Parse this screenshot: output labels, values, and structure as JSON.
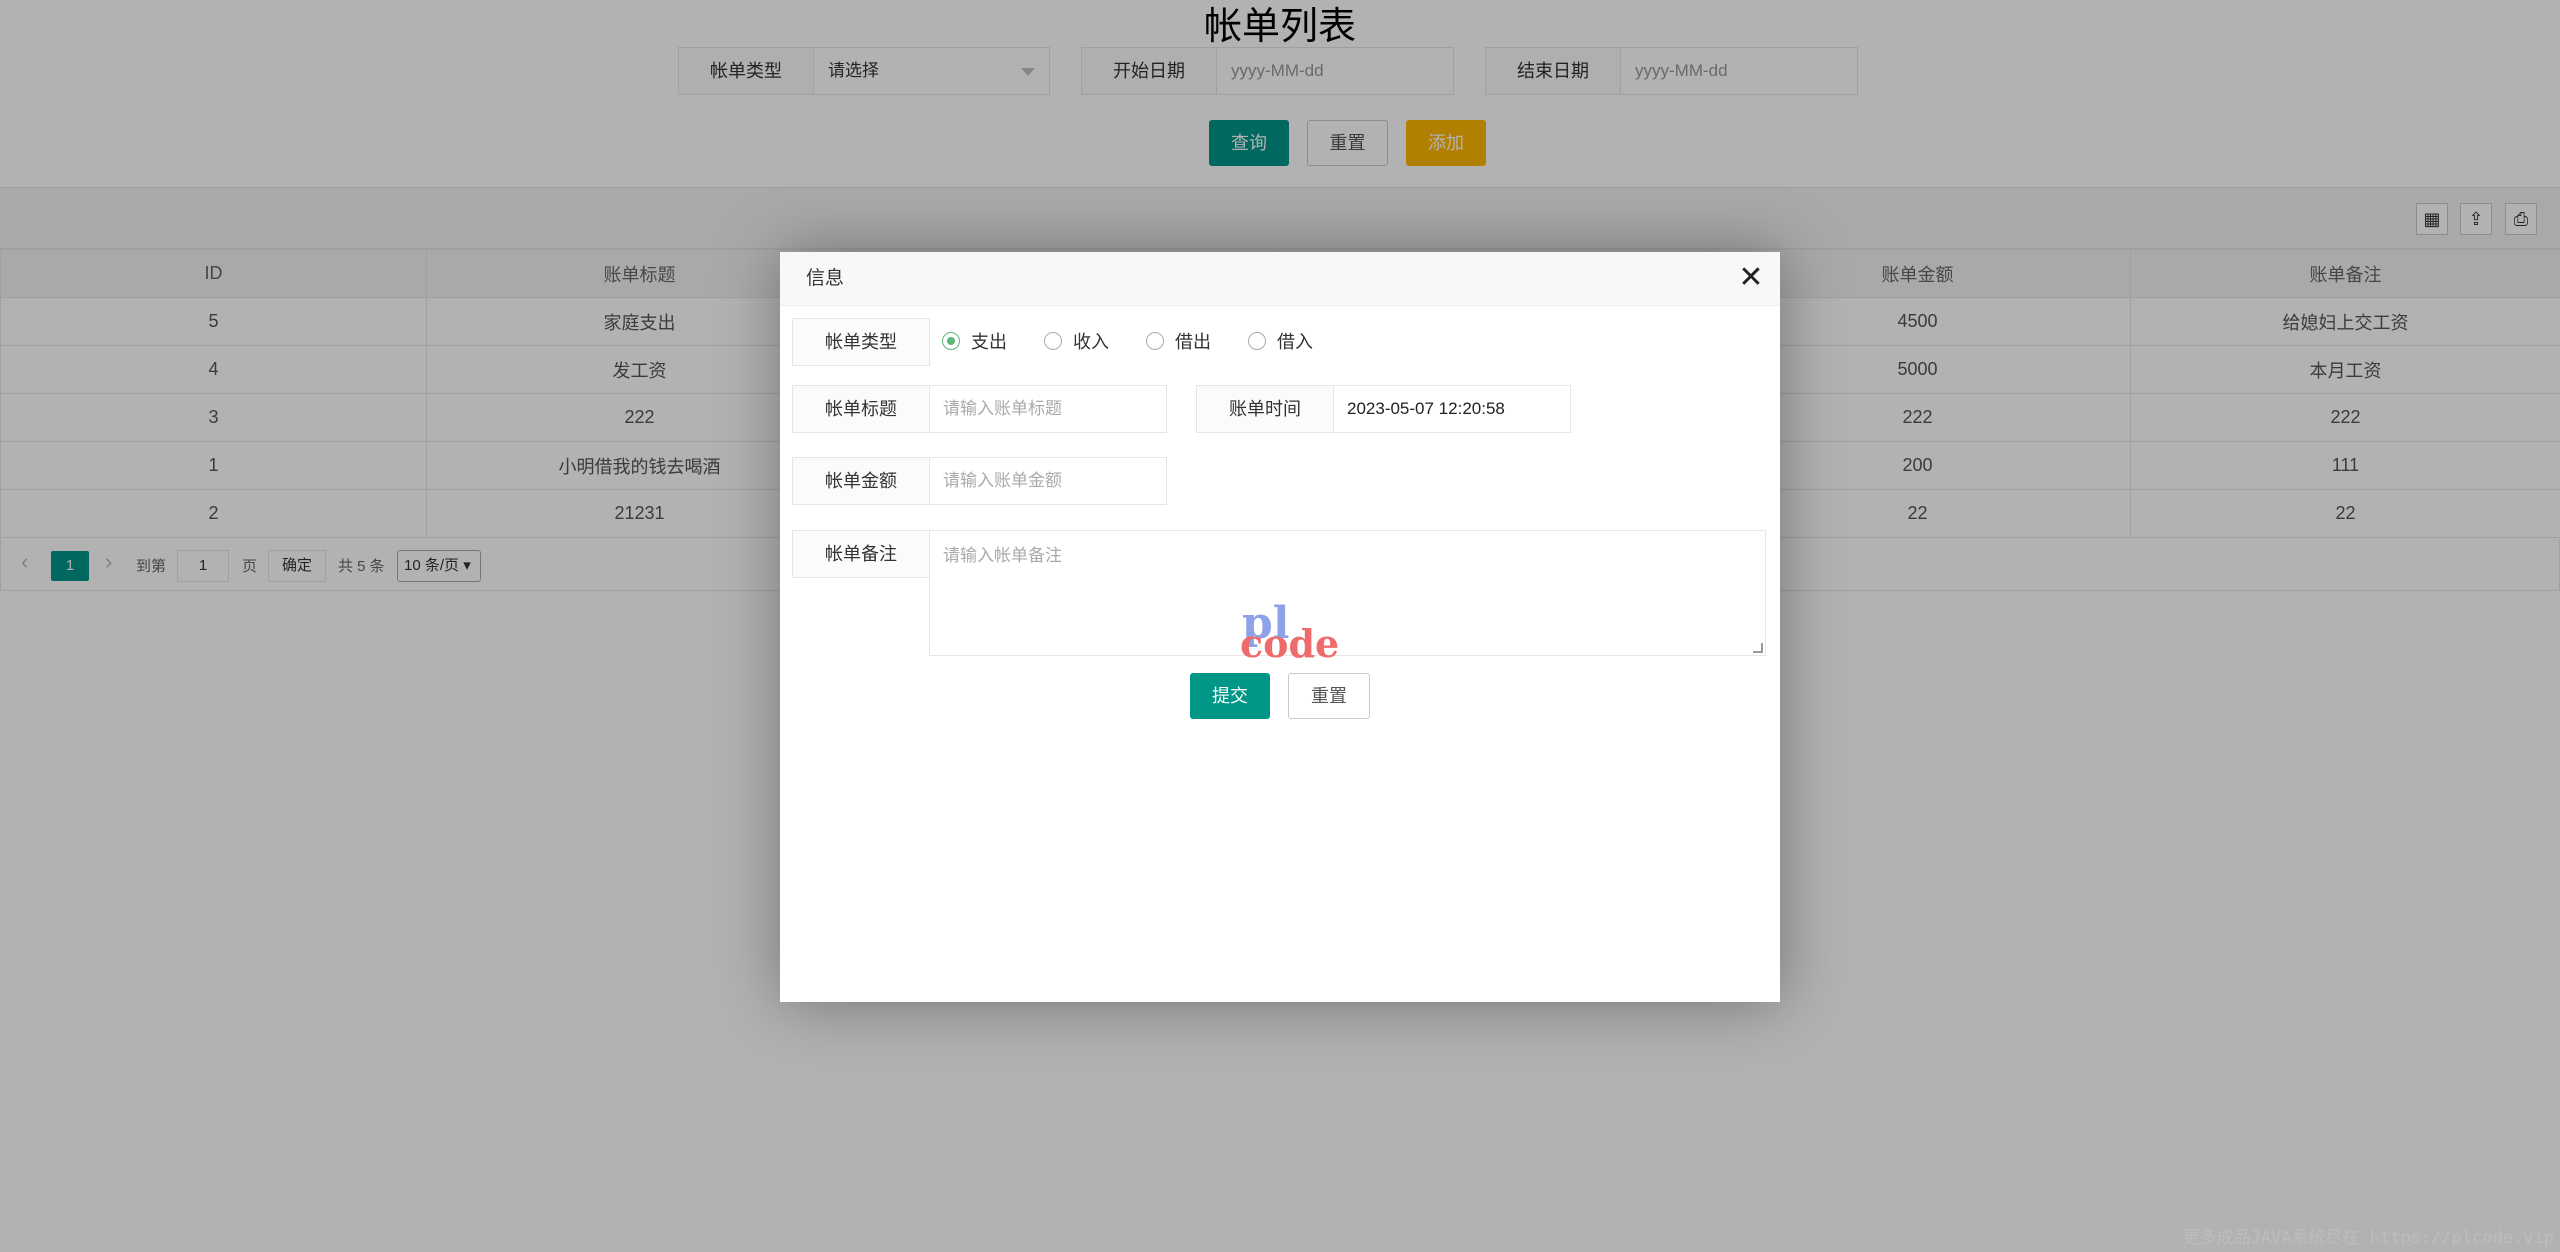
{
  "page": {
    "title": "帐单列表",
    "filters": [
      {
        "label": "帐单类型",
        "value": "请选择"
      },
      {
        "label": "开始日期",
        "placeholder": "yyyy-MM-dd"
      },
      {
        "label": "结束日期",
        "placeholder": "yyyy-MM-dd"
      }
    ],
    "buttons": {
      "query": "查询",
      "reset": "重置",
      "add": "添加"
    },
    "toolbar_icons": [
      "columns-icon",
      "export-icon",
      "print-icon"
    ],
    "table": {
      "columns": [
        "ID",
        "账单标题",
        "",
        "",
        "账单金额",
        "账单备注"
      ],
      "rows": [
        [
          "5",
          "家庭支出",
          "",
          "",
          "4500",
          "给媳妇上交工资"
        ],
        [
          "4",
          "发工资",
          "",
          "",
          "5000",
          "本月工资"
        ],
        [
          "3",
          "222",
          "",
          "",
          "222",
          "222"
        ],
        [
          "1",
          "小明借我的钱去喝酒",
          "",
          "",
          "200",
          "111"
        ],
        [
          "2",
          "21231",
          "",
          "",
          "22",
          "22"
        ]
      ]
    },
    "pager": {
      "current": "1",
      "goto_label": "到第",
      "goto_value": "1",
      "page_suffix": "页",
      "confirm": "确定",
      "total": "共 5 条",
      "page_size": "10 条/页"
    }
  },
  "modal": {
    "title": "信息",
    "close_glyph": "✕",
    "type_label": "帐单类型",
    "type_options": [
      {
        "label": "支出",
        "checked": true
      },
      {
        "label": "收入",
        "checked": false
      },
      {
        "label": "借出",
        "checked": false
      },
      {
        "label": "借入",
        "checked": false
      }
    ],
    "title_label": "帐单标题",
    "title_placeholder": "请输入账单标题",
    "time_label": "账单时间",
    "time_value": "2023-05-07 12:20:58",
    "amount_label": "帐单金额",
    "amount_placeholder": "请输入账单金额",
    "remark_label": "帐单备注",
    "remark_placeholder": "请输入帐单备注",
    "logo_line1": "pl",
    "logo_line2": "code",
    "submit": "提交",
    "reset": "重置"
  },
  "watermark": "更多成品JAVA系统尽在 https://plcode.vip",
  "colors": {
    "primary": "#009688",
    "warm": "#ffb800",
    "radio_on": "#5fb878"
  }
}
